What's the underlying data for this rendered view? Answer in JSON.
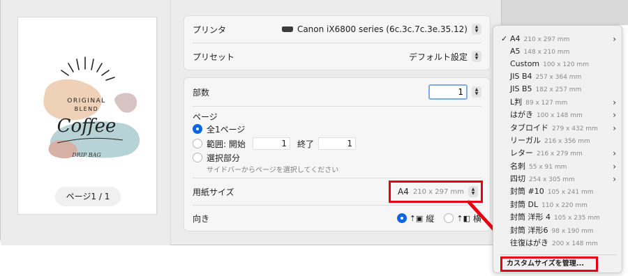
{
  "preview": {
    "page_indicator": "ページ1 / 1",
    "artwork": {
      "line1": "ORIGINAL",
      "line2": "BLEND",
      "line3": "Coffee",
      "line4": "DRIP BAG"
    }
  },
  "printer": {
    "label": "プリンタ",
    "value": "Canon iX6800 series (6c.3c.7c.3e.35.12)"
  },
  "preset": {
    "label": "プリセット",
    "value": "デフォルト設定"
  },
  "copies": {
    "label": "部数",
    "value": "1"
  },
  "pages": {
    "label": "ページ",
    "all": "全1ページ",
    "range_label": "範囲: 開始",
    "range_start": "1",
    "range_end_label": "終了",
    "range_end": "1",
    "selection_label": "選択部分",
    "selection_hint": "サイドバーからページを選択してください"
  },
  "paper_size": {
    "label": "用紙サイズ",
    "name": "A4",
    "dims": "210 x 297 mm"
  },
  "orientation": {
    "label": "向き",
    "portrait": "縦",
    "landscape": "横"
  },
  "menu": {
    "items": [
      {
        "name": "A4",
        "dims": "210 x 297 mm",
        "checked": "✓",
        "chevron": "›"
      },
      {
        "name": "A5",
        "dims": "148 x 210 mm"
      },
      {
        "name": "Custom",
        "dims": "100 x 120 mm"
      },
      {
        "name": "JIS B4",
        "dims": "257 x 364 mm"
      },
      {
        "name": "JIS B5",
        "dims": "182 x 257 mm"
      },
      {
        "name": "L判",
        "dims": "89 x 127 mm",
        "chevron": "›"
      },
      {
        "name": "はがき",
        "dims": "100 x 148 mm",
        "chevron": "›"
      },
      {
        "name": "タブロイド",
        "dims": "279 x 432 mm",
        "chevron": "›"
      },
      {
        "name": "リーガル",
        "dims": "216 x 356 mm"
      },
      {
        "name": "レター",
        "dims": "216 x 279 mm",
        "chevron": "›"
      },
      {
        "name": "名刺",
        "dims": "55 x 91 mm",
        "chevron": "›"
      },
      {
        "name": "四切",
        "dims": "254 x 305 mm",
        "chevron": "›"
      },
      {
        "name": "封筒 #10",
        "dims": "105 x 241 mm"
      },
      {
        "name": "封筒 DL",
        "dims": "110 x 220 mm"
      },
      {
        "name": "封筒 洋形 4",
        "dims": "105 x 235 mm"
      },
      {
        "name": "封筒 洋形6",
        "dims": "98 x 190 mm"
      },
      {
        "name": "往復はがき",
        "dims": "200 x 148 mm"
      }
    ],
    "manage": "カスタムサイズを管理..."
  },
  "colors": {
    "accent": "#0a66e4",
    "highlight": "#e60012"
  }
}
